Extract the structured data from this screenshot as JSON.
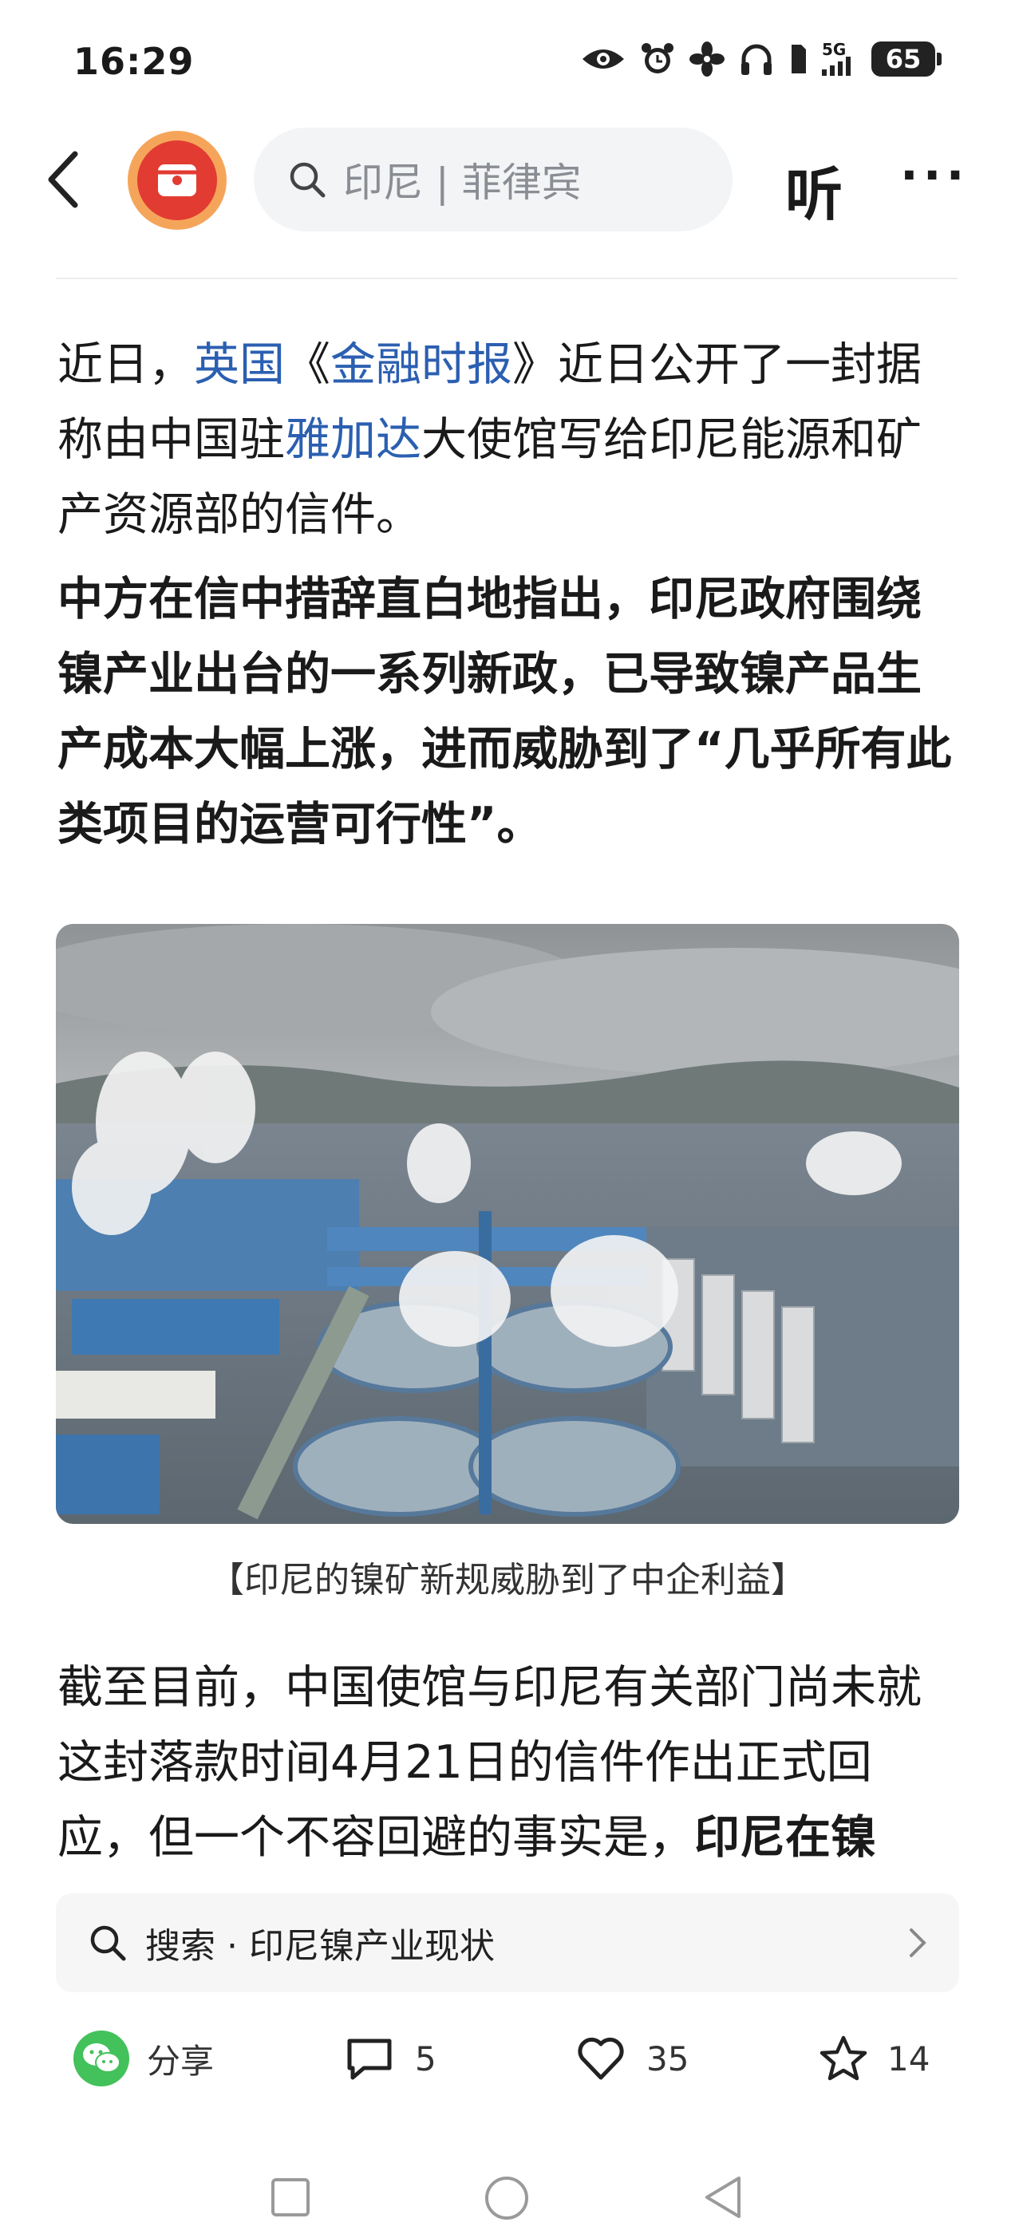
{
  "status_bar": {
    "time": "16:29",
    "network": "5G",
    "battery": "65",
    "icons": [
      "eye-icon",
      "alarm-icon",
      "fan-icon",
      "headphones-icon",
      "sim-icon",
      "signal-icon",
      "battery-icon"
    ]
  },
  "top_bar": {
    "search_text": "印尼 | 菲律宾",
    "listen_label": "听",
    "more_label": "···"
  },
  "article": {
    "p1": {
      "a": "近日，",
      "link1": "英国",
      "b": "《",
      "link2": "金融时报",
      "c": "》近日公开了一封据称由中国驻",
      "link3": "雅加达",
      "d": "大使馆写给印尼能源和矿产资源部的信件。"
    },
    "p2": "中方在信中措辞直白地指出，印尼政府围绕镍产业出台的一系列新政，已导致镍产品生产成本大幅上涨，进而威胁到了“几乎所有此类项目的运营可行性”。",
    "image_caption": "【印尼的镍矿新规威胁到了中企利益】",
    "p3": {
      "text": "截至目前，中国使馆与印尼有关部门尚未就这封落款时间4月21日的信件作出正式回应，但一个不容回避的事实是，",
      "bold": "印尼在镍"
    }
  },
  "suggestion": {
    "text": "搜索 · 印尼镍产业现状"
  },
  "actions": {
    "share_label": "分享",
    "comments": "5",
    "likes": "35",
    "favorites": "14"
  },
  "colors": {
    "link": "#2b5fb1",
    "wechat": "#43c15b",
    "avatar_red": "#e23b32",
    "avatar_ring": "#f5a55a"
  }
}
